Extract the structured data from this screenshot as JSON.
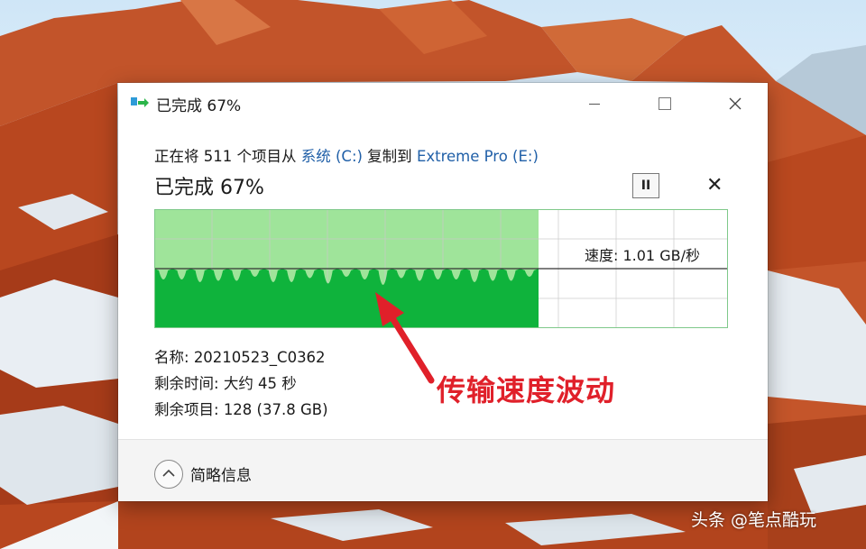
{
  "window": {
    "title": "已完成 67%",
    "minimize_label": "—",
    "maximize_label": "□",
    "close_label": "✕"
  },
  "copy": {
    "prefix": "正在将 511 个项目从 ",
    "source": "系统 (C:)",
    "middle": " 复制到 ",
    "destination": "Extreme Pro (E:)",
    "progress_title": "已完成 67%",
    "progress_percent": 67,
    "pause_label": "II",
    "cancel_label": "✕"
  },
  "graph": {
    "speed_label": "速度: 1.01 GB/秒",
    "colors": {
      "fill": "#0fb33c",
      "history": "#9fe49a",
      "grid": "#c9c9c9",
      "border": "#7fc98a"
    }
  },
  "details": {
    "name_label": "名称:",
    "name_value": "20210523_C0362",
    "time_label": "剩余时间:",
    "time_value": "大约 45 秒",
    "items_label": "剩余项目:",
    "items_value": "128 (37.8 GB)"
  },
  "annotation": {
    "text": "传输速度波动",
    "color": "#e0202a"
  },
  "footer": {
    "toggle_label": "简略信息",
    "toggle_icon": "chevron-up-icon"
  },
  "watermark": "头条 @笔点酷玩"
}
